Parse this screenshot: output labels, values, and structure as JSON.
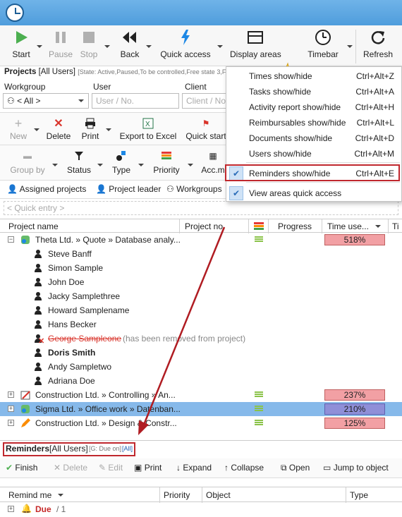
{
  "toolbar": {
    "start": "Start",
    "pause": "Pause",
    "stop": "Stop",
    "back": "Back",
    "quick_access": "Quick access",
    "display_areas": "Display areas",
    "timebar": "Timebar",
    "refresh": "Refresh"
  },
  "projects": {
    "title": "Projects",
    "scope": "[All Users]",
    "filter_text": "[State: Active,Paused,To be controlled,Free state 3,Fre..."
  },
  "filters": {
    "workgroup_label": "Workgroup",
    "workgroup_value": "< All >",
    "user_label": "User",
    "user_placeholder": "User / No.",
    "client_label": "Client",
    "client_placeholder": "Client / No"
  },
  "toolbar2": {
    "new": "New",
    "delete": "Delete",
    "print": "Print",
    "export": "Export to Excel",
    "quick_start": "Quick start"
  },
  "toolbar3": {
    "group_by": "Group by",
    "status": "Status",
    "type": "Type",
    "priority": "Priority",
    "acc": "Acc.m"
  },
  "tabs": {
    "assigned": "Assigned projects",
    "leader": "Project leader",
    "workgroups": "Workgroups"
  },
  "quick_entry_placeholder": "< Quick entry >",
  "grid": {
    "columns": [
      "Project name",
      "Project no.",
      "Progress",
      "Time use...",
      "Ti"
    ],
    "rows": [
      {
        "name": "Theta Ltd. » Quote » Database analy...",
        "pct": "518%"
      },
      {
        "name": "Steve Banff"
      },
      {
        "name": "Simon Sample"
      },
      {
        "name": "John Doe"
      },
      {
        "name": "Jacky Samplethree"
      },
      {
        "name": "Howard Samplename"
      },
      {
        "name": "Hans Becker"
      },
      {
        "name": "George Sampleone",
        "note": "(has been removed from project)"
      },
      {
        "name": "Doris Smith"
      },
      {
        "name": "Andy Sampletwo"
      },
      {
        "name": "Adriana Doe"
      },
      {
        "name": "Construction Ltd. » Controlling » An...",
        "pct": "237%"
      },
      {
        "name": "Sigma Ltd. » Office work » Datenban...",
        "pct": "210%"
      },
      {
        "name": "Construction Ltd. » Design & Constr...",
        "pct": "125%"
      }
    ]
  },
  "menu": {
    "items": [
      {
        "label": "Times show/hide",
        "shortcut": "Ctrl+Alt+Z"
      },
      {
        "label": "Tasks show/hide",
        "shortcut": "Ctrl+Alt+A"
      },
      {
        "label": "Activity report show/hide",
        "shortcut": "Ctrl+Alt+H"
      },
      {
        "label": "Reimbursables show/hide",
        "shortcut": "Ctrl+Alt+L"
      },
      {
        "label": "Documents show/hide",
        "shortcut": "Ctrl+Alt+D"
      },
      {
        "label": "Users show/hide",
        "shortcut": "Ctrl+Alt+M"
      },
      {
        "label": "Reminders show/hide",
        "shortcut": "Ctrl+Alt+E"
      },
      {
        "label": "View areas quick access",
        "shortcut": ""
      }
    ]
  },
  "reminders": {
    "title": "Reminders",
    "scope": "[All Users]",
    "filter": "[G: Due on]",
    "all_link": "[All]",
    "toolbar": {
      "finish": "Finish",
      "delete": "Delete",
      "edit": "Edit",
      "print": "Print",
      "expand": "Expand",
      "collapse": "Collapse",
      "open": "Open",
      "jump": "Jump to object"
    },
    "columns": [
      "Remind me",
      "Priority",
      "Object",
      "Type"
    ],
    "row": {
      "label": "Due",
      "count": "/ 1"
    }
  },
  "colors": {
    "accent": "#4f9ddc",
    "highlight": "#c0282e",
    "selection": "#86b9ea",
    "overrun": "#f2a0a4"
  }
}
